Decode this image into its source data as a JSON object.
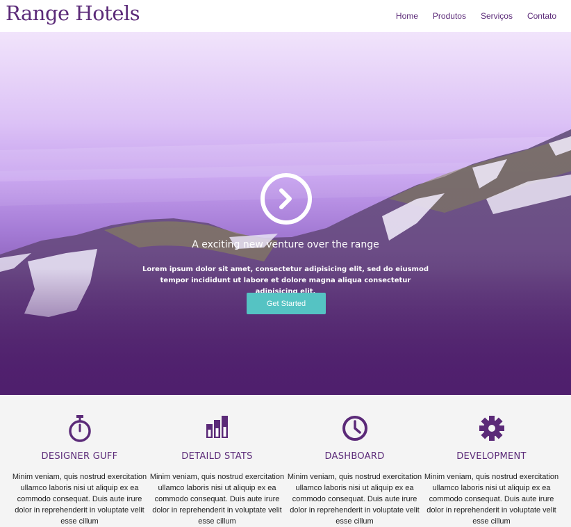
{
  "header": {
    "logo": "Range Hotels",
    "nav": [
      "Home",
      "Produtos",
      "Serviços",
      "Contato"
    ]
  },
  "hero": {
    "title": "A exciting new venture over the range",
    "text": "Lorem ipsum dolor sit amet, consectetur adipisicing elit, sed do eiusmod tempor incididunt ut labore et dolore magna aliqua consectetur adipisicing elit.",
    "button": "Get Started"
  },
  "features": [
    {
      "icon": "stopwatch-icon",
      "title": "DESIGNER GUFF",
      "text": "Minim veniam, quis nostrud exercitation ullamco laboris nisi ut aliquip ex ea commodo consequat. Duis aute irure dolor in reprehenderit in voluptate velit esse cillum"
    },
    {
      "icon": "bar-chart-icon",
      "title": "DETAILD STATS",
      "text": "Minim veniam, quis nostrud exercitation ullamco laboris nisi ut aliquip ex ea commodo consequat. Duis aute irure dolor in reprehenderit in voluptate velit esse cillum"
    },
    {
      "icon": "clock-icon",
      "title": "DASHBOARD",
      "text": "Minim veniam, quis nostrud exercitation ullamco laboris nisi ut aliquip ex ea commodo consequat. Duis aute irure dolor in reprehenderit in voluptate velit esse cillum"
    },
    {
      "icon": "gear-icon",
      "title": "DEVELOPMENT",
      "text": "Minim veniam, quis nostrud exercitation ullamco laboris nisi ut aliquip ex ea commodo consequat. Duis aute irure dolor in reprehenderit in voluptate velit esse cillum"
    }
  ],
  "colors": {
    "brand": "#5b2a78",
    "accent": "#55c3c3"
  }
}
